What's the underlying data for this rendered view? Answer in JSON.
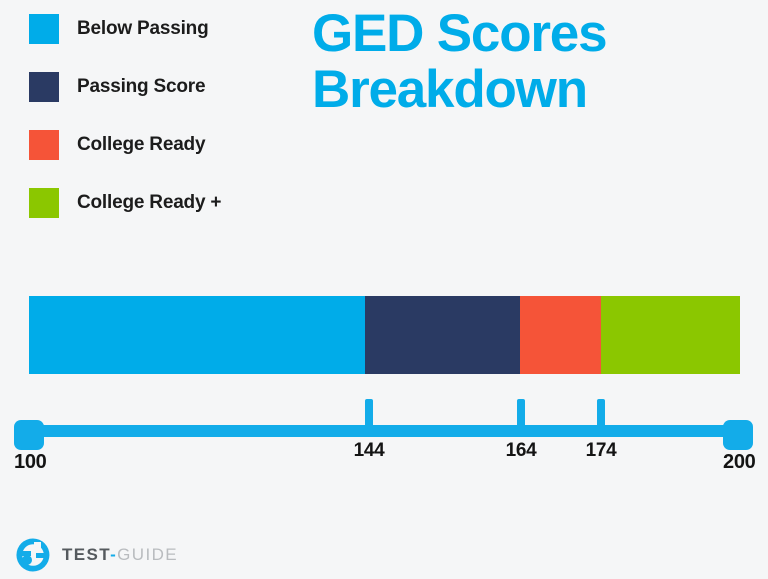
{
  "background_color": "#f5f6f7",
  "title": {
    "line1": "GED Scores",
    "line2": "Breakdown",
    "color": "#00ace9"
  },
  "legend": {
    "items": [
      {
        "label": "Below Passing",
        "color": "#00ace9"
      },
      {
        "label": "Passing Score",
        "color": "#2a3a63"
      },
      {
        "label": "College Ready",
        "color": "#f55438"
      },
      {
        "label": "College Ready +",
        "color": "#8bc700"
      }
    ]
  },
  "chart_data": {
    "type": "bar",
    "orientation": "horizontal-stacked",
    "title": "GED Scores Breakdown",
    "xlabel": "",
    "ylabel": "",
    "xlim": [
      100,
      200
    ],
    "grid": false,
    "legend_position": "top-left",
    "axis_ticks": [
      "100",
      "144",
      "164",
      "174",
      "200"
    ],
    "axis_tick_values": [
      100,
      144,
      164,
      174,
      200
    ],
    "categories": [
      "Below Passing",
      "Passing Score",
      "College Ready",
      "College Ready +"
    ],
    "segments": [
      {
        "name": "Below Passing",
        "start": 100,
        "end": 144,
        "span": 44,
        "color": "#00ace9"
      },
      {
        "name": "Passing Score",
        "start": 144,
        "end": 165,
        "span": 21,
        "color": "#2a3a63"
      },
      {
        "name": "College Ready",
        "start": 165,
        "end": 176,
        "span": 11,
        "color": "#f55438"
      },
      {
        "name": "College Ready +",
        "start": 176,
        "end": 200,
        "span": 24,
        "color": "#8bc700"
      }
    ],
    "values": [
      44,
      21,
      11,
      24
    ]
  },
  "axis": {
    "min_label": "100",
    "max_label": "200",
    "ticks": [
      {
        "label": "144",
        "value": 144
      },
      {
        "label": "164",
        "value": 164
      },
      {
        "label": "174",
        "value": 174
      }
    ],
    "color": "#13ace9"
  },
  "logo": {
    "mark": "test-guide-logo-icon",
    "text_primary": "TEST",
    "text_separator": "-",
    "text_secondary": "GUIDE"
  }
}
